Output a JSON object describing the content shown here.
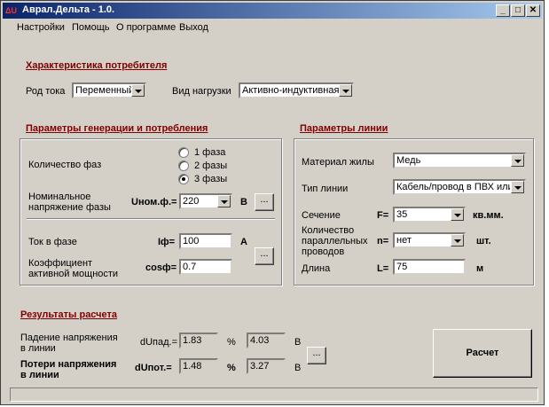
{
  "window": {
    "title": "Аврал.Дельта - 1.0.",
    "icon_text": "ΔU"
  },
  "menu": [
    "Настройки",
    "Помощь",
    "О программе",
    "Выход"
  ],
  "consumer": {
    "title": "Характеристика потребителя",
    "current_type_label": "Род тока",
    "current_type_value": "Переменный",
    "load_type_label": "Вид нагрузки",
    "load_type_value": "Активно-индуктивная"
  },
  "generation": {
    "title": "Параметры генерации и потребления",
    "phases_label": "Количество фаз",
    "phase_options": [
      "1 фаза",
      "2 фазы",
      "3 фазы"
    ],
    "phase_selected": 2,
    "voltage_label_1": "Номинальное",
    "voltage_label_2": "напряжение фазы",
    "voltage_symbol": "Uном.ф.=",
    "voltage_value": "220",
    "voltage_unit": "В",
    "current_label": "Ток в фазе",
    "current_symbol": "Iф=",
    "current_value": "100",
    "current_unit": "А",
    "pf_label_1": "Коэффициент",
    "pf_label_2": "активной мощности",
    "pf_symbol": "cosф=",
    "pf_value": "0.7",
    "ellipsis": "..."
  },
  "line": {
    "title": "Параметры линии",
    "material_label": "Материал жилы",
    "material_value": "Медь",
    "line_type_label": "Тип линии",
    "line_type_value": "Кабель/провод в ПВХ или",
    "section_label": "Сечение",
    "section_symbol": "F=",
    "section_value": "35",
    "section_unit": "кв.мм.",
    "parallel_label_1": "Количество",
    "parallel_label_2": "параллельных",
    "parallel_label_3": "проводов",
    "parallel_symbol": "n=",
    "parallel_value": "нет",
    "parallel_unit": "шт.",
    "length_label": "Длина",
    "length_symbol": "L=",
    "length_value": "75",
    "length_unit": "м"
  },
  "results": {
    "title": "Результаты расчета",
    "drop_label_1": "Падение напряжения",
    "drop_label_2": "в линии",
    "drop_symbol": "dUпад.=",
    "drop_percent": "1.83",
    "drop_volts": "4.03",
    "loss_label_1": "Потери напряжения",
    "loss_label_2": "в линии",
    "loss_symbol": "dUпот.=",
    "loss_percent": "1.48",
    "loss_volts": "3.27",
    "percent_unit": "%",
    "volt_unit": "В",
    "ellipsis": "...",
    "calculate_label": "Расчет"
  }
}
